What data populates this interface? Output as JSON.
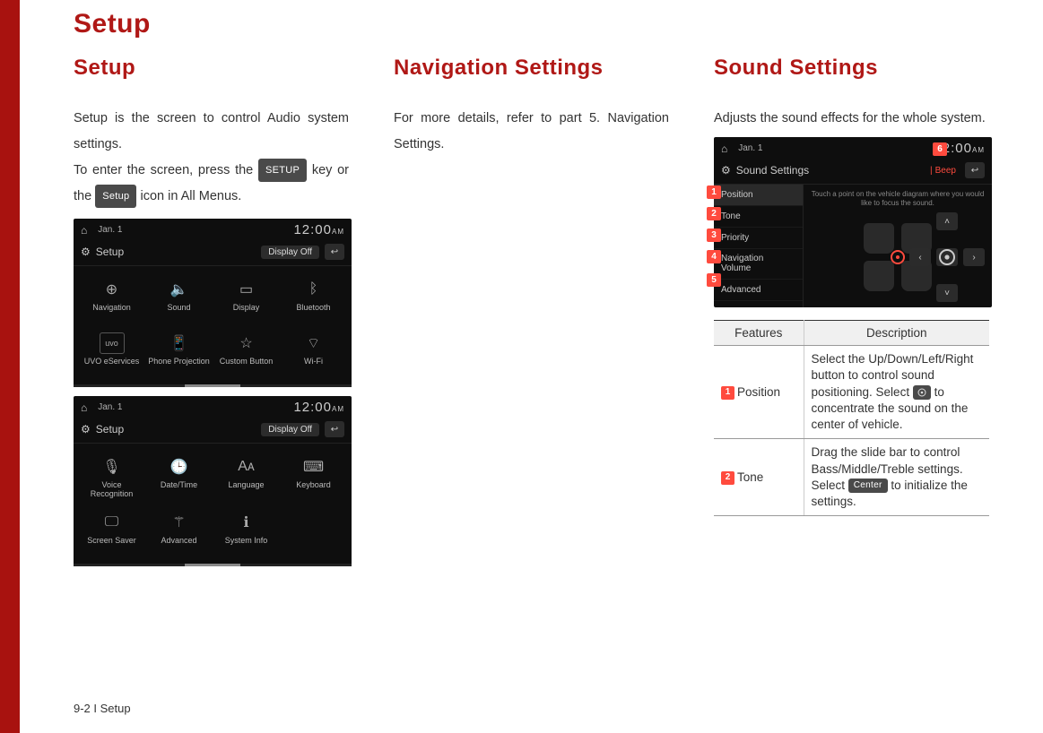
{
  "page": {
    "title": "Setup",
    "footer": "9-2 I Setup"
  },
  "col1": {
    "title": "Setup",
    "p1": "Setup is the screen to control Audio system settings.",
    "p2a": "To enter the screen, press the ",
    "p2_key1": "SETUP",
    "p2b": " key or the ",
    "p2_key2": "Setup",
    "p2c": " icon in All Menus."
  },
  "col2": {
    "title": "Navigation Settings",
    "p1": "For more details, refer to part 5. Navigation Settings."
  },
  "col3": {
    "title": "Sound Settings",
    "p1": "Adjusts the sound effects for the whole system."
  },
  "shot_common": {
    "home": "⌂",
    "date": "Jan. 1",
    "time": "12:00",
    "ampm": "AM",
    "gear": "⚙",
    "setup_label": "Setup",
    "display_off": "Display Off",
    "back": "↩"
  },
  "shot1": {
    "cells": [
      {
        "icon": "compass-icon",
        "label": "Navigation"
      },
      {
        "icon": "speaker-icon",
        "label": "Sound"
      },
      {
        "icon": "display-icon",
        "label": "Display"
      },
      {
        "icon": "bluetooth-icon",
        "label": "Bluetooth"
      },
      {
        "icon": "uvo-icon",
        "label": "UVO eServices"
      },
      {
        "icon": "phone-icon",
        "label": "Phone Projection"
      },
      {
        "icon": "star-icon",
        "label": "Custom Button"
      },
      {
        "icon": "wifi-icon",
        "label": "Wi-Fi"
      }
    ]
  },
  "shot2": {
    "cells": [
      {
        "icon": "mic-icon",
        "label": "Voice Recognition"
      },
      {
        "icon": "clock-icon",
        "label": "Date/Time"
      },
      {
        "icon": "language-icon",
        "label": "Language"
      },
      {
        "icon": "keyboard-icon",
        "label": "Keyboard"
      },
      {
        "icon": "screensaver-icon",
        "label": "Screen Saver"
      },
      {
        "icon": "advanced-icon",
        "label": "Advanced"
      },
      {
        "icon": "info-icon",
        "label": "System Info"
      }
    ]
  },
  "sound_shot": {
    "title": "Sound Settings",
    "beep": "Beep",
    "hint": "Touch a point on the vehicle diagram where you would like to focus the sound.",
    "items": [
      {
        "n": "1",
        "label": "Position"
      },
      {
        "n": "2",
        "label": "Tone"
      },
      {
        "n": "3",
        "label": "Priority"
      },
      {
        "n": "4",
        "label": "Navigation Volume"
      },
      {
        "n": "5",
        "label": "Advanced"
      }
    ],
    "tag6": "6"
  },
  "table": {
    "h1": "Features",
    "h2": "Description",
    "rows": [
      {
        "n": "1",
        "feat": "Position",
        "desc_a": "Select the Up/Down/Left/Right button to control sound positioning. Select ",
        "desc_b": " to concentrate the sound on the center of vehicle."
      },
      {
        "n": "2",
        "feat": "Tone",
        "desc_a": "Drag the slide bar to control Bass/Middle/Treble settings. Select ",
        "chip": "Center",
        "desc_b": " to initialize the settings."
      }
    ]
  }
}
